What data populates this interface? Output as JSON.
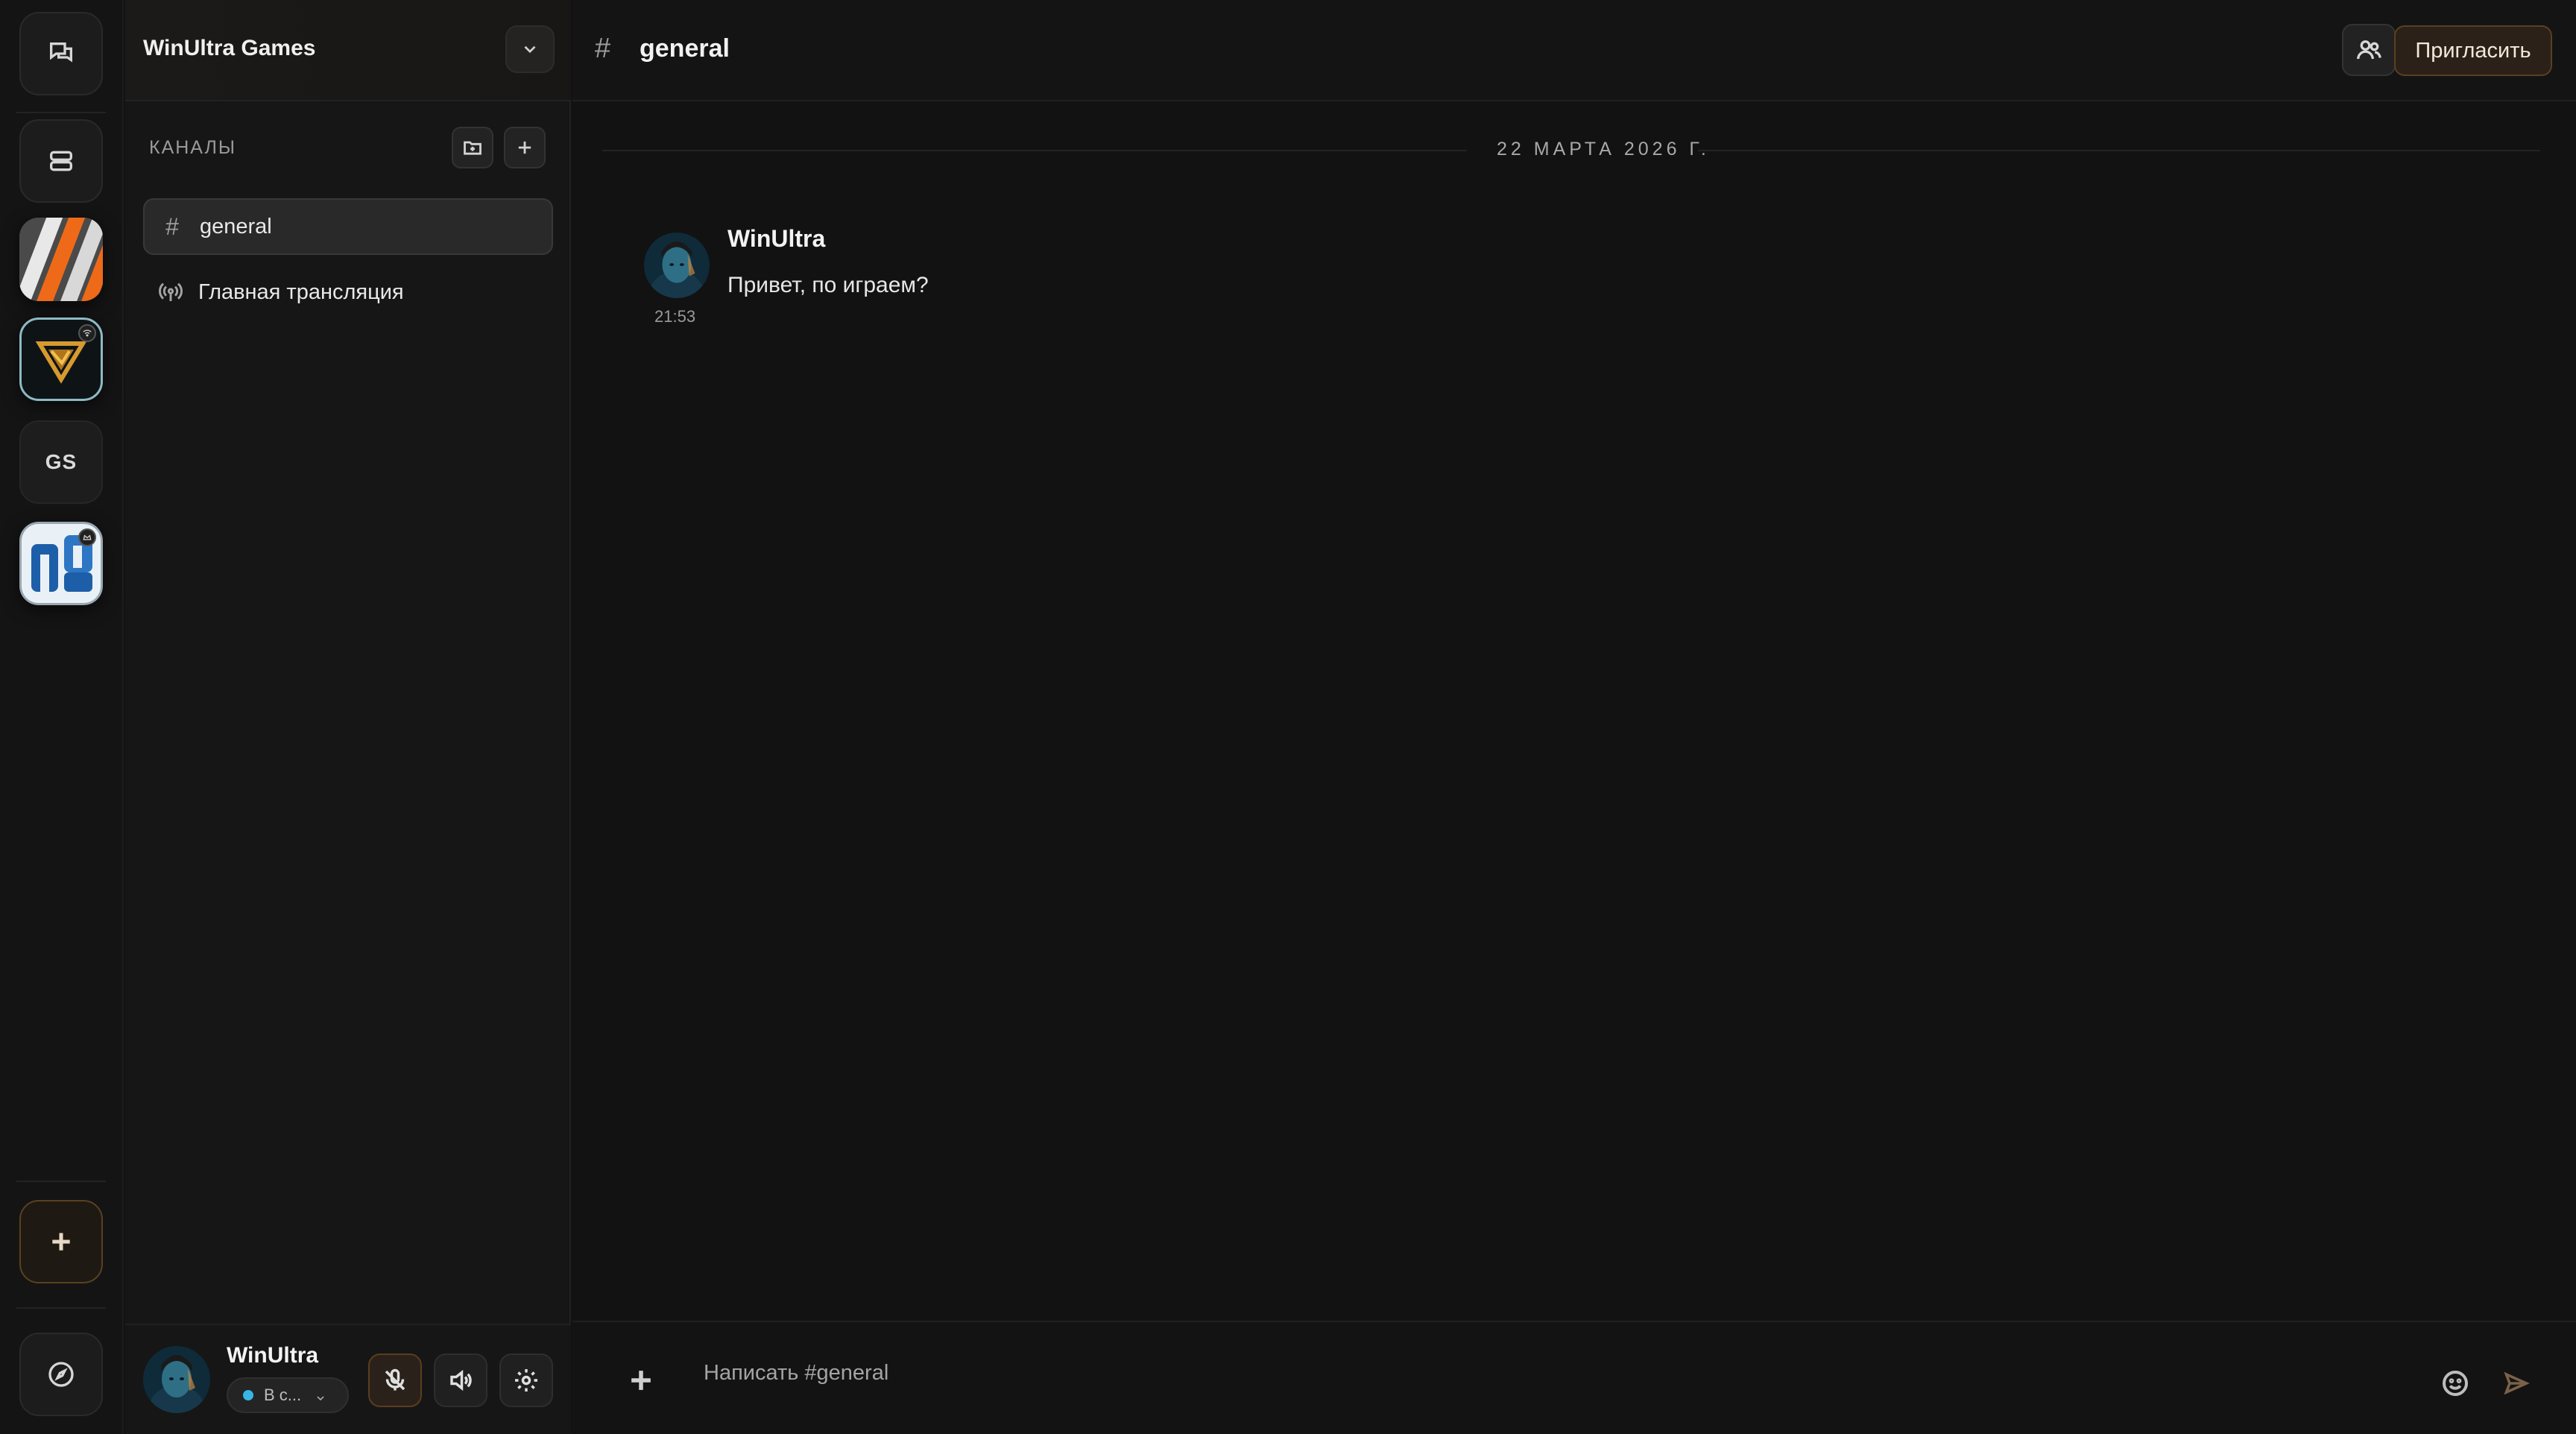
{
  "colors": {
    "accent_brown": "#5a4021",
    "status_online": "#37b6e6",
    "background": "#121212"
  },
  "rail": {
    "servers": [
      {
        "name": "server-orange-stripes",
        "kind": "image"
      },
      {
        "name": "server-gold-logo",
        "kind": "image"
      },
      {
        "name": "server-gs",
        "kind": "text",
        "label": "GS"
      },
      {
        "name": "server-blue-logo",
        "kind": "image"
      }
    ],
    "icons": {
      "messages": "chat-icon",
      "servers": "server-stack-icon",
      "add": "plus-icon",
      "discover": "compass-icon"
    }
  },
  "server": {
    "name": "WinUltra Games"
  },
  "channels": {
    "section_label": "КАНАЛЫ",
    "items": [
      {
        "name": "general",
        "type": "text",
        "active": true
      },
      {
        "name": "Главная трансляция",
        "type": "broadcast",
        "active": false
      }
    ]
  },
  "user": {
    "name": "WinUltra",
    "status_label": "В с..."
  },
  "header": {
    "channel_name": "general",
    "invite_label": "Пригласить"
  },
  "messages": {
    "date_separator": "22 МАРТА 2026 Г.",
    "items": [
      {
        "author": "WinUltra",
        "time": "21:53",
        "text": "Привет, по играем?"
      }
    ]
  },
  "composer": {
    "placeholder": "Написать #general"
  }
}
